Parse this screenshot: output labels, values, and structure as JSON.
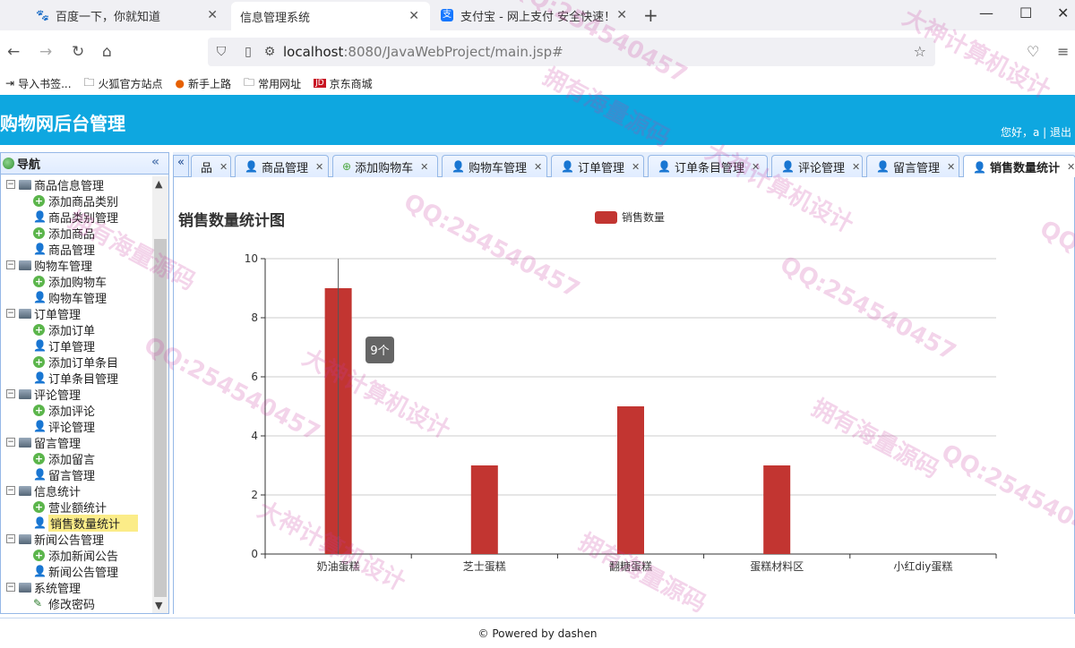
{
  "browser": {
    "tabs": [
      {
        "label": "百度一下，你就知道",
        "icon": "baidu-icon"
      },
      {
        "label": "信息管理系统",
        "icon": "none"
      },
      {
        "label": "支付宝 - 网上支付 安全快速！",
        "icon": "alipay-icon"
      }
    ],
    "url_host": "localhost",
    "url_rest": ":8080/JavaWebProject/main.jsp#",
    "bookmarks": [
      "导入书签...",
      "火狐官方站点",
      "新手上路",
      "常用网址",
      "京东商城"
    ]
  },
  "app": {
    "title": "购物网后台管理",
    "greeting": "您好，a | 退出",
    "footer": "© Powered by dashen"
  },
  "sidebar": {
    "title": "导航",
    "tree": [
      {
        "type": "group",
        "label": "商品信息管理"
      },
      {
        "type": "leaf",
        "icon": "plus",
        "label": "添加商品类别"
      },
      {
        "type": "leaf",
        "icon": "user",
        "label": "商品类别管理"
      },
      {
        "type": "leaf",
        "icon": "plus",
        "label": "添加商品"
      },
      {
        "type": "leaf",
        "icon": "user",
        "label": "商品管理"
      },
      {
        "type": "group",
        "label": "购物车管理"
      },
      {
        "type": "leaf",
        "icon": "plus",
        "label": "添加购物车"
      },
      {
        "type": "leaf",
        "icon": "user",
        "label": "购物车管理"
      },
      {
        "type": "group",
        "label": "订单管理"
      },
      {
        "type": "leaf",
        "icon": "plus",
        "label": "添加订单"
      },
      {
        "type": "leaf",
        "icon": "user",
        "label": "订单管理"
      },
      {
        "type": "leaf",
        "icon": "plus",
        "label": "添加订单条目"
      },
      {
        "type": "leaf",
        "icon": "user",
        "label": "订单条目管理"
      },
      {
        "type": "group",
        "label": "评论管理"
      },
      {
        "type": "leaf",
        "icon": "plus",
        "label": "添加评论"
      },
      {
        "type": "leaf",
        "icon": "user",
        "label": "评论管理"
      },
      {
        "type": "group",
        "label": "留言管理"
      },
      {
        "type": "leaf",
        "icon": "plus",
        "label": "添加留言"
      },
      {
        "type": "leaf",
        "icon": "user",
        "label": "留言管理"
      },
      {
        "type": "group",
        "label": "信息统计"
      },
      {
        "type": "leaf",
        "icon": "plus",
        "label": "营业额统计"
      },
      {
        "type": "leaf",
        "icon": "user",
        "label": "销售数量统计",
        "selected": true
      },
      {
        "type": "group",
        "label": "新闻公告管理"
      },
      {
        "type": "leaf",
        "icon": "plus",
        "label": "添加新闻公告"
      },
      {
        "type": "leaf",
        "icon": "user",
        "label": "新闻公告管理"
      },
      {
        "type": "group",
        "label": "系统管理"
      },
      {
        "type": "leaf",
        "icon": "pen",
        "label": "修改密码"
      }
    ]
  },
  "main_tabs": [
    {
      "label": "品",
      "icon": "none",
      "width": 45
    },
    {
      "label": "商品管理",
      "icon": "user"
    },
    {
      "label": "添加购物车",
      "icon": "plus"
    },
    {
      "label": "购物车管理",
      "icon": "user"
    },
    {
      "label": "订单管理",
      "icon": "user"
    },
    {
      "label": "订单条目管理",
      "icon": "user"
    },
    {
      "label": "评论管理",
      "icon": "user"
    },
    {
      "label": "留言管理",
      "icon": "user"
    },
    {
      "label": "销售数量统计",
      "icon": "user",
      "active": true
    }
  ],
  "chart_data": {
    "type": "bar",
    "title": "销售数量统计图",
    "legend": "销售数量",
    "categories": [
      "奶油蛋糕",
      "芝士蛋糕",
      "翻糖蛋糕",
      "蛋糕材料区",
      "小红diy蛋糕"
    ],
    "values": [
      9,
      3,
      5,
      3,
      0
    ],
    "ylim": [
      0,
      10
    ],
    "yticks": [
      0,
      2,
      4,
      6,
      8,
      10
    ],
    "color": "#c23531",
    "tooltip": "9个",
    "grid": true
  },
  "watermarks": [
    "QQ:254540457",
    "大神计算机设计",
    "拥有海量源码"
  ]
}
